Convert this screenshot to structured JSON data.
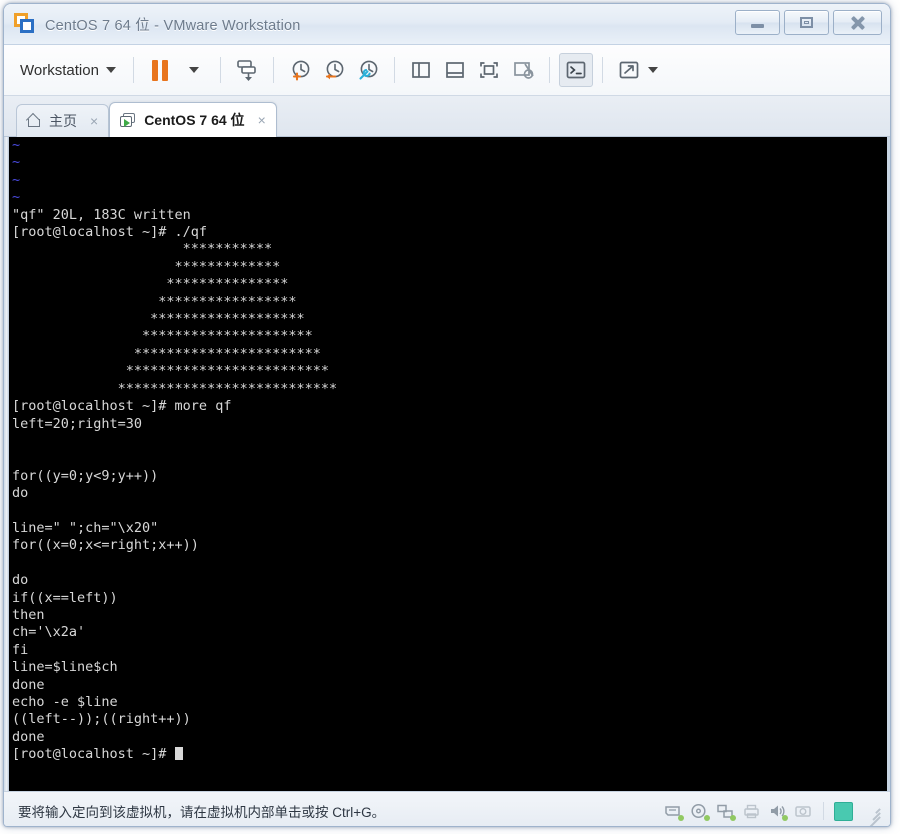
{
  "window": {
    "title": "CentOS 7 64 位 - VMware Workstation",
    "app_icon": "vmware-logo-icon",
    "controls": {
      "minimize": "minimize-button",
      "maximize": "restore-button",
      "close": "close-button"
    }
  },
  "toolbar": {
    "workstation_menu": "Workstation",
    "buttons": [
      {
        "name": "pause-vm-button",
        "icon": "pause-icon"
      },
      {
        "name": "pause-dropdown-button",
        "icon": "chevron-down-icon"
      },
      {
        "name": "power-button",
        "icon": "power-icon"
      },
      {
        "name": "take-snapshot-button",
        "icon": "snapshot-add-icon"
      },
      {
        "name": "revert-snapshot-button",
        "icon": "snapshot-revert-icon"
      },
      {
        "name": "snapshot-manager-button",
        "icon": "snapshot-manager-icon"
      },
      {
        "name": "show-library-button",
        "icon": "library-panel-icon"
      },
      {
        "name": "show-thumbnail-bar-button",
        "icon": "thumbnail-bar-icon"
      },
      {
        "name": "full-screen-button",
        "icon": "fullscreen-icon"
      },
      {
        "name": "unity-mode-button",
        "icon": "unity-mode-icon"
      },
      {
        "name": "console-view-button",
        "icon": "console-view-icon"
      },
      {
        "name": "fit-window-button",
        "icon": "fit-window-icon"
      },
      {
        "name": "fit-window-dropdown-button",
        "icon": "chevron-down-icon"
      }
    ]
  },
  "tabs": [
    {
      "label": "主页",
      "icon": "home-icon",
      "close": "×",
      "active": false
    },
    {
      "label": "CentOS 7 64 位",
      "icon": "vm-icon",
      "close": "×",
      "active": true
    }
  ],
  "terminal": {
    "prompt": "[root@localhost ~]#",
    "vim_tildes": [
      "~",
      "~",
      "~",
      "~"
    ],
    "lines": [
      "\"qf\" 20L, 183C written",
      "[root@localhost ~]# ./qf",
      "                     ***********",
      "                    *************",
      "                   ***************",
      "                  *****************",
      "                 *******************",
      "                *********************",
      "               ***********************",
      "              *************************",
      "             ***************************",
      "[root@localhost ~]# more qf",
      "left=20;right=30",
      "",
      "",
      "for((y=0;y<9;y++))",
      "do",
      "",
      "line=\" \";ch=\"\\x20\"",
      "for((x=0;x<=right;x++))",
      "",
      "do",
      "if((x==left))",
      "then",
      "ch='\\x2a'",
      "fi",
      "line=$line$ch",
      "done",
      "echo -e $line",
      "((left--));((right++))",
      "done"
    ],
    "final_prompt": "[root@localhost ~]# ",
    "bg_color": "#000000",
    "fg_color": "#d8d8d8",
    "tilde_color": "#4a4ae0"
  },
  "statusbar": {
    "message": "要将输入定向到该虚拟机，请在虚拟机内部单击或按 Ctrl+G。",
    "devices": [
      {
        "name": "hard-disk-icon"
      },
      {
        "name": "cd-dvd-icon"
      },
      {
        "name": "network-adapter-icon"
      },
      {
        "name": "printer-icon"
      },
      {
        "name": "sound-card-icon"
      },
      {
        "name": "camera-icon"
      },
      {
        "name": "notes-icon"
      }
    ]
  },
  "colors": {
    "accent_orange": "#e8741d",
    "accent_blue": "#2bb0d8",
    "device_active_green": "#7ec143",
    "title_text": "#6d7b8c"
  }
}
